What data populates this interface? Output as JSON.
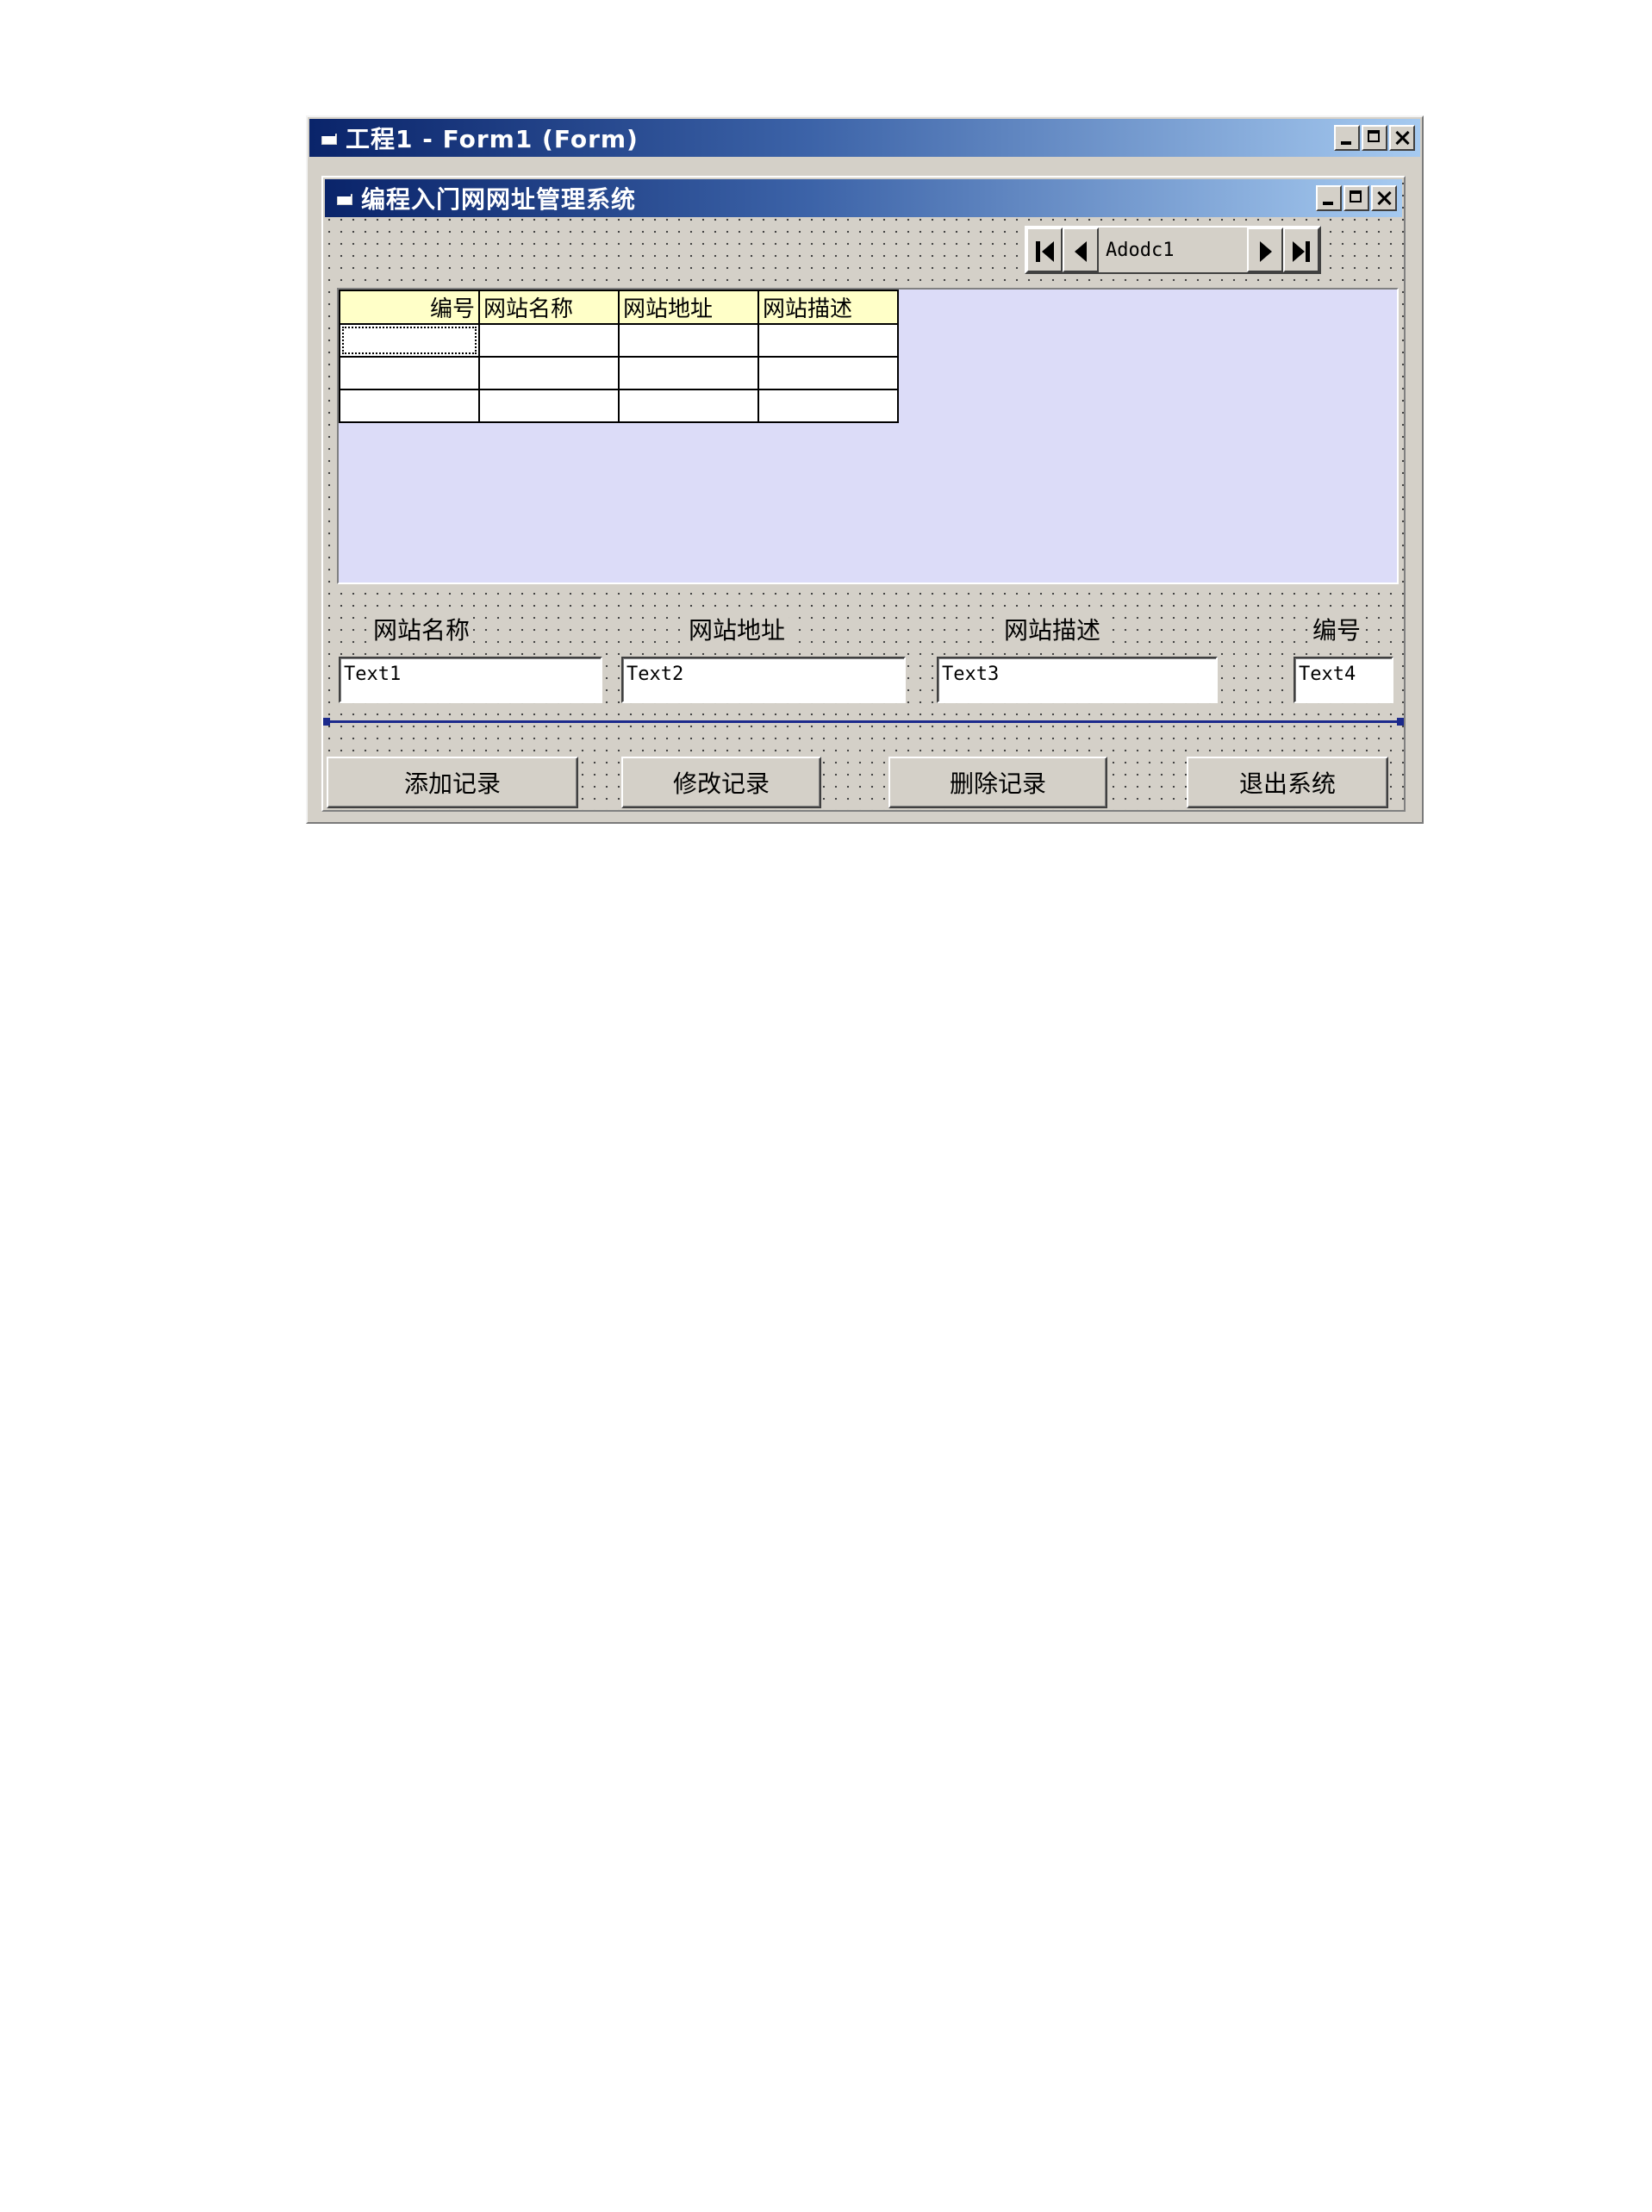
{
  "ide_window": {
    "title": "工程1 - Form1 (Form)"
  },
  "form": {
    "title": "编程入门网网址管理系统",
    "adodc": {
      "caption": "Adodc1"
    },
    "grid": {
      "headers": [
        "编号",
        "网站名称",
        "网站地址",
        "网站描述"
      ],
      "rows": [
        [
          "",
          "",
          "",
          ""
        ],
        [
          "",
          "",
          "",
          ""
        ],
        [
          "",
          "",
          "",
          ""
        ]
      ]
    },
    "labels": {
      "name": "网站名称",
      "address": "网站地址",
      "description": "网站描述",
      "id": "编号"
    },
    "textboxes": {
      "name": "Text1",
      "address": "Text2",
      "description": "Text3",
      "id": "Text4"
    },
    "buttons": {
      "add": "添加记录",
      "edit": "修改记录",
      "delete": "删除记录",
      "exit": "退出系统"
    }
  }
}
